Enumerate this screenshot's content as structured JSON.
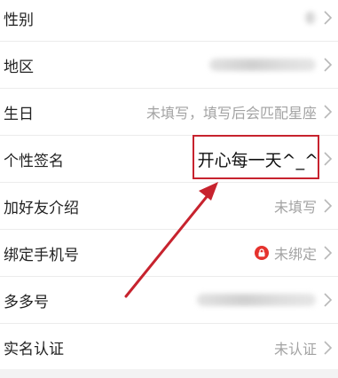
{
  "rows": [
    {
      "label": "性别",
      "value": ""
    },
    {
      "label": "地区",
      "value": ""
    },
    {
      "label": "生日",
      "value": "未填写，填写后会匹配星座"
    },
    {
      "label": "个性签名",
      "value": "开心每一天^_^"
    },
    {
      "label": "加好友介绍",
      "value": "未填写"
    },
    {
      "label": "绑定手机号",
      "value": "未绑定"
    },
    {
      "label": "多多号",
      "value": ""
    },
    {
      "label": "实名认证",
      "value": "未认证"
    }
  ],
  "icons": {
    "chevron": "chevron-right-icon",
    "lock": "lock-icon"
  },
  "colors": {
    "annotation_red": "#c7232e",
    "lock_badge_red": "#e5322d",
    "value_gray": "#a3a3a3",
    "label_dark": "#222222"
  }
}
